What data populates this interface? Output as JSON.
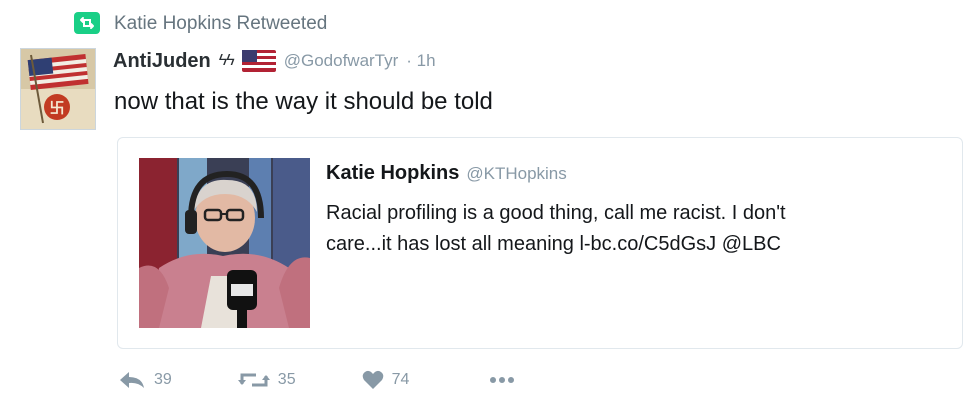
{
  "retweet_context": {
    "text": "Katie Hopkins Retweeted",
    "icon": "retweet-icon"
  },
  "tweet": {
    "display_name": "AntiJuden",
    "name_suffix": "ϟϟ",
    "handle": "@GodofwarTyr",
    "time": "· 1h",
    "text": "now that is the way it should be told"
  },
  "quoted_tweet": {
    "display_name": "Katie Hopkins",
    "handle": "@KTHopkins",
    "text_line1": "Racial profiling is a good thing, call me racist. I don't",
    "text_line2": "care...it has lost all meaning l-bc.co/C5dGsJ @LBC"
  },
  "actions": {
    "reply": {
      "count": "39",
      "icon": "reply-icon"
    },
    "retweet": {
      "count": "35",
      "icon": "retweet-icon"
    },
    "like": {
      "count": "74",
      "icon": "heart-icon"
    },
    "more": {
      "icon": "more-dots-icon"
    }
  },
  "colors": {
    "retweet_green": "#19cf86",
    "muted": "#8899a6",
    "text": "#14171a"
  }
}
